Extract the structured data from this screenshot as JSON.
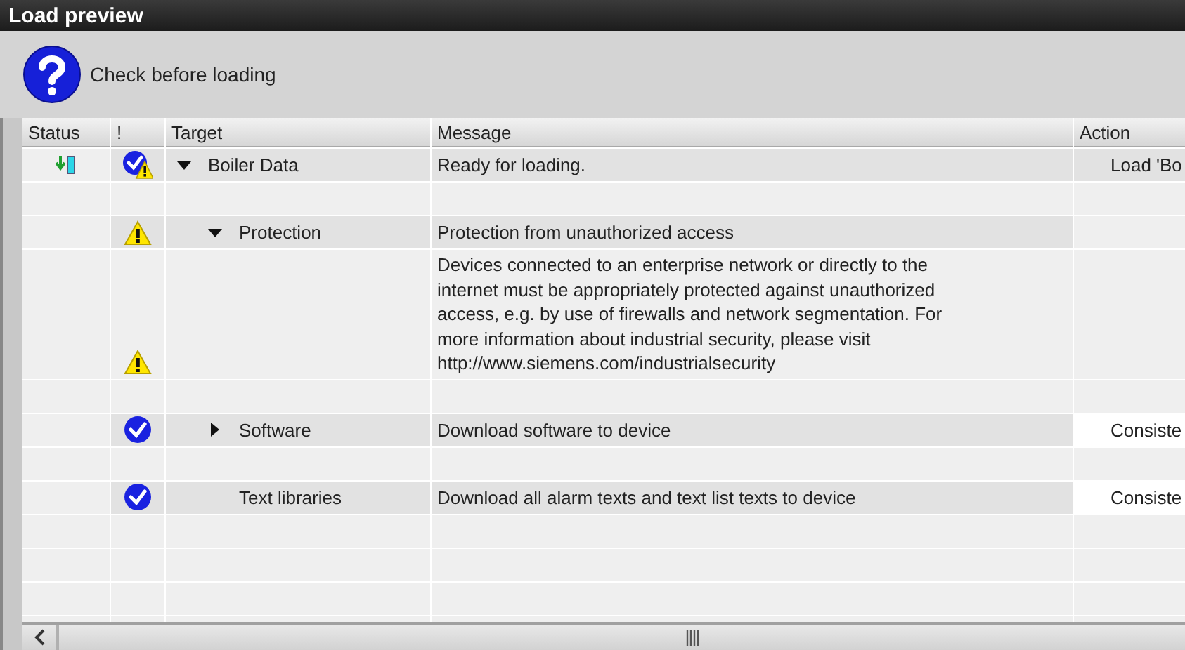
{
  "window": {
    "title": "Load preview"
  },
  "header": {
    "message": "Check before loading"
  },
  "table": {
    "columns": [
      "Status",
      "!",
      "Target",
      "Message",
      "Action"
    ],
    "rows": [
      {
        "target": "Boiler Data",
        "status": {
          "kind": "download"
        },
        "alert": {
          "kind": "check_warning"
        },
        "expanded": true,
        "message": "Ready for loading.",
        "action": {
          "text": "Load 'Bo",
          "kind": "plain"
        },
        "children": [
          {
            "target": "Protection",
            "alert": {
              "kind": "warning"
            },
            "expanded": true,
            "message": "Protection from unauthorized access",
            "details": {
              "alert": {
                "kind": "warning"
              },
              "lines": [
                "Devices connected to an enterprise network or directly to the",
                "internet must be appropriately protected against unauthorized",
                "access, e.g. by use of firewalls and network segmentation. For",
                "more information about industrial security, please visit",
                "http://www.siemens.com/industrialsecurity"
              ]
            }
          },
          {
            "target": "Software",
            "alert": {
              "kind": "check"
            },
            "expanded": false,
            "message": "Download software to device",
            "action": {
              "text": "Consiste",
              "kind": "dropdown"
            }
          },
          {
            "target": "Text libraries",
            "alert": {
              "kind": "check"
            },
            "message": "Download all alarm texts and text list texts to device",
            "action": {
              "text": "Consiste",
              "kind": "dropdown"
            }
          }
        ]
      }
    ]
  }
}
